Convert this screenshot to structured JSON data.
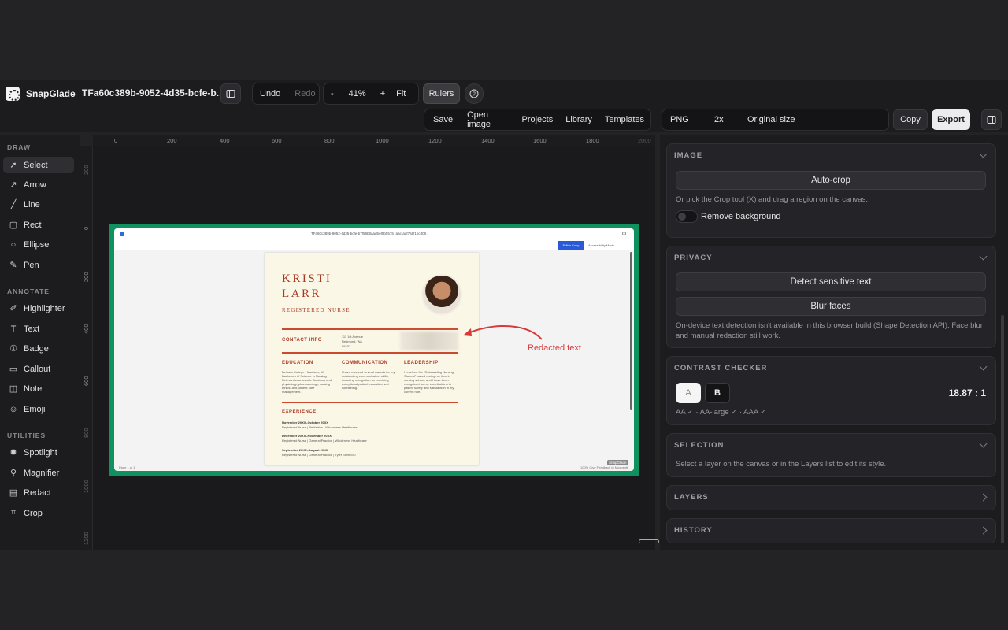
{
  "app": {
    "name": "SnapGlade",
    "doc_title": "TFa60c389b-9052-4d35-bcfe-b..."
  },
  "toolbar": {
    "undo": "Undo",
    "redo": "Redo",
    "zoom_out": "-",
    "zoom": "41%",
    "zoom_in": "+",
    "fit": "Fit",
    "rulers": "Rulers",
    "save": "Save",
    "open_image": "Open image",
    "projects": "Projects",
    "library": "Library",
    "templates": "Templates",
    "format": "PNG",
    "scale": "2x",
    "size": "Original size",
    "copy": "Copy",
    "export": "Export"
  },
  "tools": {
    "draw_label": "DRAW",
    "annotate_label": "ANNOTATE",
    "utilities_label": "UTILITIES",
    "draw": [
      {
        "label": "Select",
        "icon": "cursor-icon"
      },
      {
        "label": "Arrow",
        "icon": "arrow-icon"
      },
      {
        "label": "Line",
        "icon": "line-icon"
      },
      {
        "label": "Rect",
        "icon": "rect-icon"
      },
      {
        "label": "Ellipse",
        "icon": "ellipse-icon"
      },
      {
        "label": "Pen",
        "icon": "pen-icon"
      }
    ],
    "annotate": [
      {
        "label": "Highlighter",
        "icon": "highlighter-icon"
      },
      {
        "label": "Text",
        "icon": "text-icon"
      },
      {
        "label": "Badge",
        "icon": "badge-icon"
      },
      {
        "label": "Callout",
        "icon": "callout-icon"
      },
      {
        "label": "Note",
        "icon": "note-icon"
      },
      {
        "label": "Emoji",
        "icon": "emoji-icon"
      }
    ],
    "utilities": [
      {
        "label": "Spotlight",
        "icon": "spotlight-icon"
      },
      {
        "label": "Magnifier",
        "icon": "magnifier-icon"
      },
      {
        "label": "Redact",
        "icon": "redact-icon"
      },
      {
        "label": "Crop",
        "icon": "crop-icon"
      }
    ]
  },
  "ruler": {
    "h": [
      "0",
      "200",
      "400",
      "600",
      "800",
      "1000",
      "1200",
      "1400",
      "1600",
      "1800",
      "2000"
    ],
    "v": [
      "200",
      "0",
      "200",
      "400",
      "600",
      "800",
      "1000",
      "1200"
    ]
  },
  "canvas": {
    "url": "TFa60c389b-9052-4d35-bcfe-b7f59b8aad5ef9b5575 ‹aac-adf7a8f1bc309 ›",
    "edit_copy": "Edit a Copy",
    "accessibility": "Accessibility Mode",
    "resume": {
      "name1": "KRISTI",
      "name2": "LARR",
      "role": "REGISTERED NURSE",
      "contact": "CONTACT INFO",
      "address": [
        "111 1st Avenue",
        "Redmond, WA",
        "65432"
      ],
      "edu_h": "EDUCATION",
      "comm_h": "COMMUNICATION",
      "lead_h": "LEADERSHIP",
      "edu": "Bellows College | Madison, WI Bachelors of Science in Nursing Relevant coursework: Anatomy and physiology, pharmacology, nursing ethics, and patient care management.",
      "comm": "I have received several awards for my outstanding communication skills, including recognition for providing exceptional patient education and counseling.",
      "lead": "I received the \"Outstanding Nursing Student\" award during my time in nursing school, and I have been recognized for my contributions to patient safety and satisfaction in my current role.",
      "exp_h": "EXPERIENCE",
      "exp": [
        {
          "d": "November 20XX–October 20XX",
          "r": "Registered Nurse | Pediatrics | Wholeness Healthcare"
        },
        {
          "d": "December 20XX–November 20XX",
          "r": "Registered Nurse | General Practice | Wholeness Healthcare"
        },
        {
          "d": "September 20XX–August 20XX",
          "r": "Registered Nurse | General Practice | Tyler Stein MD"
        }
      ]
    },
    "annotation": "Redacted text",
    "page_label": "Page 1 of 1",
    "footer_right": "100%   Give Feedback to Microsoft",
    "watermark": "SnapGlade"
  },
  "panel": {
    "image": {
      "title": "IMAGE",
      "autocrop": "Auto-crop",
      "hint": "Or pick the Crop tool (X) and drag a region on the canvas.",
      "remove_bg": "Remove background"
    },
    "privacy": {
      "title": "PRIVACY",
      "detect": "Detect sensitive text",
      "blur": "Blur faces",
      "note": "On-device text detection isn't available in this browser build (Shape Detection API). Face blur and manual redaction still work."
    },
    "contrast": {
      "title": "CONTRAST CHECKER",
      "a": "A",
      "b": "B",
      "ratio": "18.87 : 1",
      "result": "AA ✓ · AA-large ✓ · AAA ✓"
    },
    "selection": {
      "title": "SELECTION",
      "hint": "Select a layer on the canvas or in the Layers list to edit its style."
    },
    "layers": {
      "title": "LAYERS"
    },
    "history": {
      "title": "HISTORY"
    }
  },
  "colors": {
    "accent": "#109160",
    "red": "#d63a3a",
    "rust": "#a83a22"
  }
}
